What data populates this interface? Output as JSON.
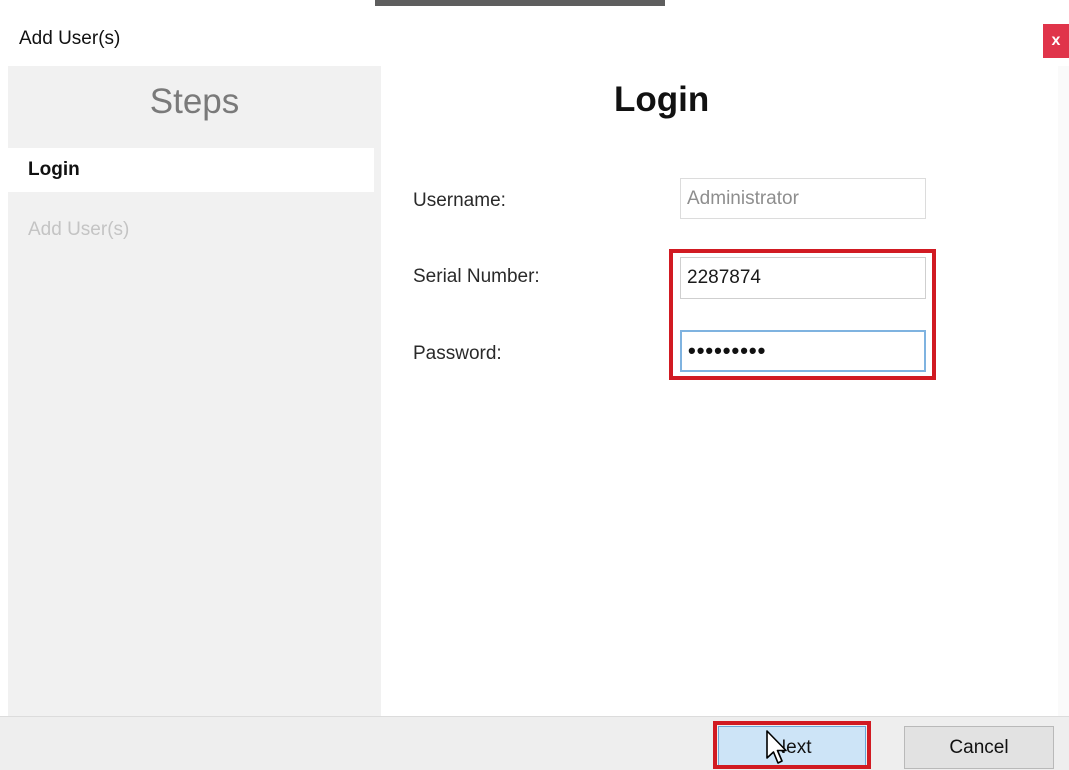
{
  "window": {
    "title": "Add User(s)",
    "close_glyph": "x"
  },
  "sidebar": {
    "heading": "Steps",
    "items": [
      {
        "label": "Login",
        "state": "active"
      },
      {
        "label": "Add User(s)",
        "state": "inactive"
      }
    ]
  },
  "main": {
    "title": "Login",
    "fields": {
      "username": {
        "label": "Username:",
        "value": "Administrator"
      },
      "serial": {
        "label": "Serial Number:",
        "value": "2287874"
      },
      "password": {
        "label": "Password:",
        "value": "•••••••••"
      }
    }
  },
  "footer": {
    "next_label": "Next",
    "cancel_label": "Cancel"
  },
  "colors": {
    "highlight": "#d11a22",
    "close_bg": "#e0344a",
    "next_bg": "#cde4f7"
  },
  "icons": {
    "close": "close-icon",
    "cursor": "mouse-pointer-icon"
  }
}
